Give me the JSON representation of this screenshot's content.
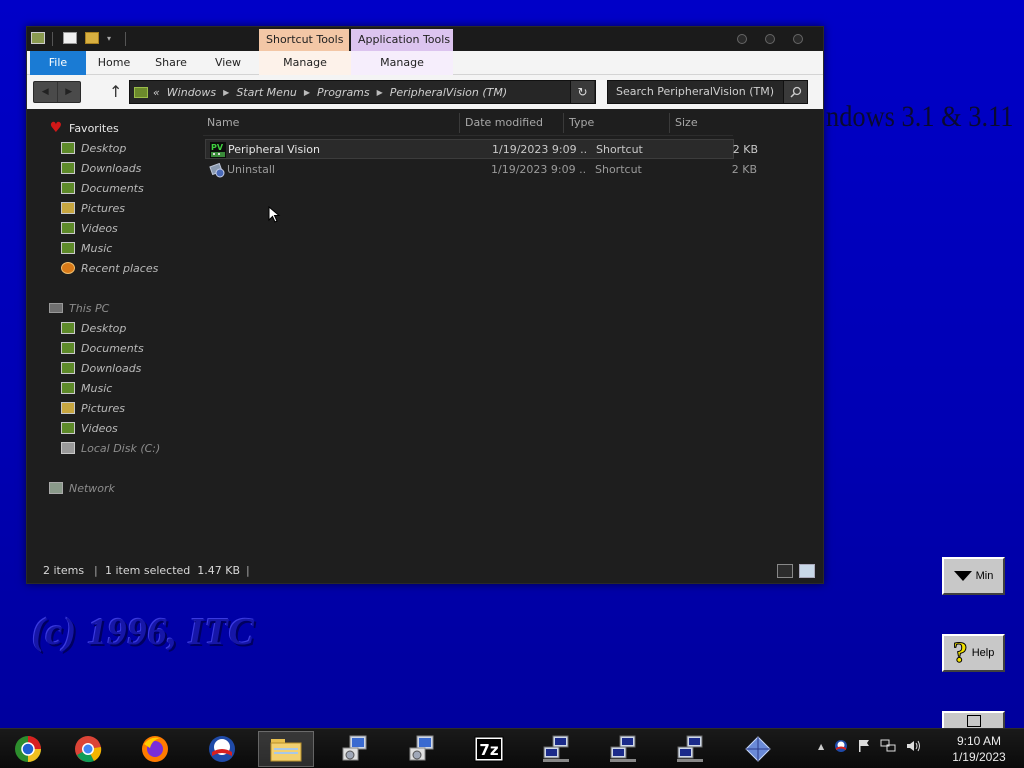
{
  "desktop": {
    "title_fragment": "ndows 3.1 & 3.11",
    "copyright": "(c) 1996, ITC",
    "min_button_label": "Min",
    "help_button_label": "Help"
  },
  "window": {
    "context_tabs": {
      "shortcut_tools": "Shortcut Tools",
      "application_tools": "Application Tools"
    },
    "ribbon_tabs": [
      "File",
      "Home",
      "Share",
      "View",
      "Manage",
      "Manage"
    ],
    "address": {
      "prefix": "«",
      "crumbs": [
        "Windows",
        "Start Menu",
        "Programs",
        "PeripheralVision (TM)"
      ]
    },
    "search_placeholder": "Search PeripheralVision (TM)",
    "help_glyph": "?"
  },
  "navigation": {
    "favorites": {
      "label": "Favorites",
      "items": [
        "Desktop",
        "Downloads",
        "Documents",
        "Pictures",
        "Videos",
        "Music",
        "Recent places"
      ]
    },
    "this_pc": {
      "label": "This PC",
      "items": [
        "Desktop",
        "Documents",
        "Downloads",
        "Music",
        "Pictures",
        "Videos",
        "Local Disk (C:)"
      ]
    },
    "network": {
      "label": "Network"
    }
  },
  "files": {
    "columns": [
      "Name",
      "Date modified",
      "Type",
      "Size"
    ],
    "rows": [
      {
        "name": "Peripheral Vision",
        "date": "1/19/2023 9:09 ...",
        "type": "Shortcut",
        "size": "2 KB",
        "selected": true
      },
      {
        "name": "Uninstall",
        "date": "1/19/2023 9:09 ...",
        "type": "Shortcut",
        "size": "2 KB",
        "selected": false
      }
    ]
  },
  "status": {
    "items_count": "2 items",
    "selection": "1 item selected  1.47 KB"
  },
  "taskbar": {
    "apps": [
      "media-center",
      "chrome",
      "firefox",
      "obama-logo",
      "file-explorer",
      "setup-1",
      "setup-2",
      "7-zip",
      "network-app-1",
      "network-app-2",
      "network-app-3",
      "diamond-app"
    ],
    "clock_time": "9:10 AM",
    "clock_date": "1/19/2023"
  },
  "colors": {
    "desktop_blue": "#0000c8",
    "file_tab_blue": "#1a7bd4",
    "shortcut_tools": "#f3c7a6",
    "application_tools": "#dcc4ef",
    "window_dark": "#1e1e1e"
  }
}
